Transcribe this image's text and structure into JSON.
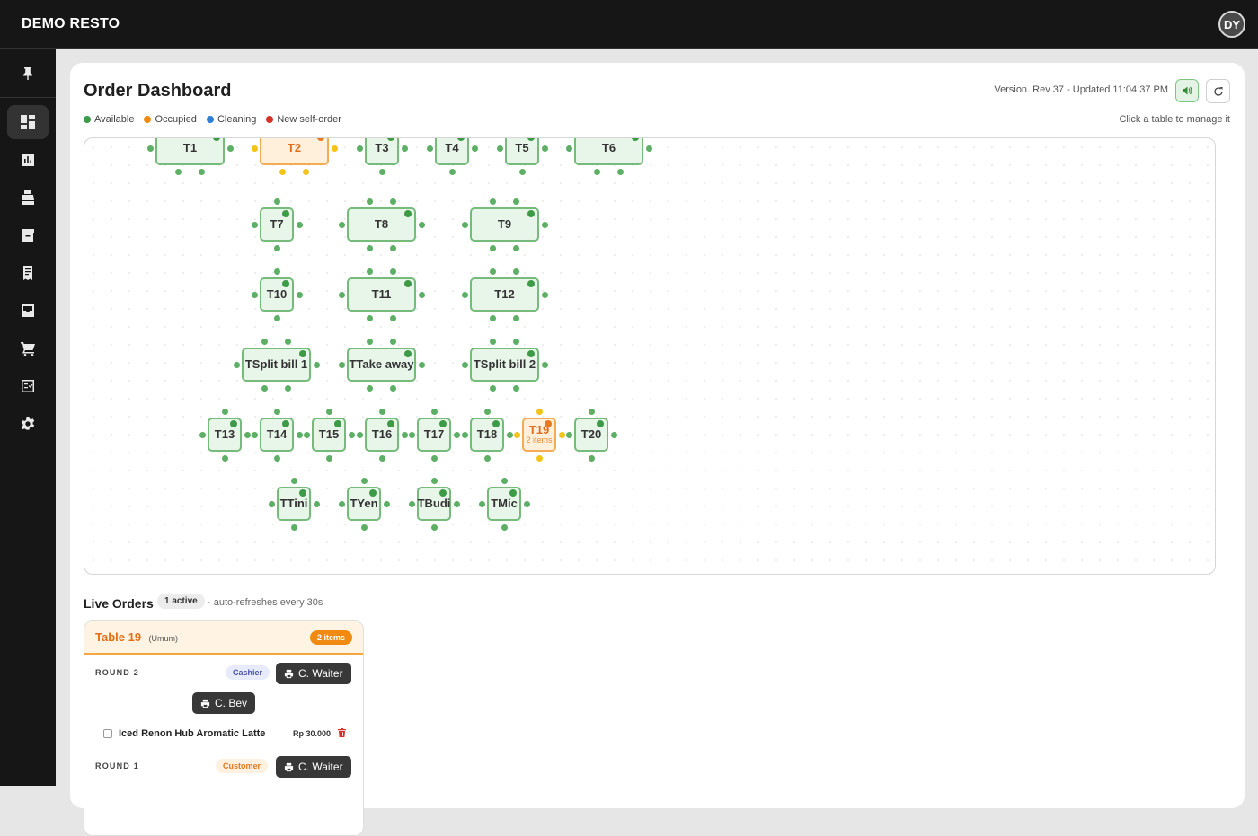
{
  "app": {
    "brand": "DEMO RESTO",
    "user_initials": "DY"
  },
  "sidebar": {
    "items": [
      {
        "icon": "dashboard-icon",
        "active": true
      },
      {
        "icon": "bar-chart-icon"
      },
      {
        "icon": "cash-register-icon"
      },
      {
        "icon": "archive-icon"
      },
      {
        "icon": "receipt-icon"
      },
      {
        "icon": "inbox-icon"
      },
      {
        "icon": "cart-icon"
      },
      {
        "icon": "checklist-icon"
      },
      {
        "icon": "gear-icon"
      }
    ]
  },
  "header": {
    "title": "Order Dashboard",
    "version": "Version. Rev 37 - Updated 11:04:37 PM",
    "hint": "Click a table to manage it"
  },
  "legend": [
    {
      "label": "Available",
      "color": "#3d9a46"
    },
    {
      "label": "Occupied",
      "color": "#f08a12"
    },
    {
      "label": "Cleaning",
      "color": "#2f7fd6"
    },
    {
      "label": "New self-order",
      "color": "#d93025"
    }
  ],
  "tables": [
    {
      "id": "T1",
      "label": "T1",
      "status": "available"
    },
    {
      "id": "T2",
      "label": "T2",
      "status": "occupied"
    },
    {
      "id": "T3",
      "label": "T3",
      "status": "available"
    },
    {
      "id": "T4",
      "label": "T4",
      "status": "available"
    },
    {
      "id": "T5",
      "label": "T5",
      "status": "available"
    },
    {
      "id": "T6",
      "label": "T6",
      "status": "available"
    },
    {
      "id": "T7",
      "label": "T7",
      "status": "available"
    },
    {
      "id": "T8",
      "label": "T8",
      "status": "available"
    },
    {
      "id": "T9",
      "label": "T9",
      "status": "available"
    },
    {
      "id": "T10",
      "label": "T10",
      "status": "available"
    },
    {
      "id": "T11",
      "label": "T11",
      "status": "available"
    },
    {
      "id": "T12",
      "label": "T12",
      "status": "available"
    },
    {
      "id": "TSplit1",
      "label": "TSplit bill 1",
      "status": "available"
    },
    {
      "id": "TTakeaway",
      "label": "TTake away",
      "status": "available"
    },
    {
      "id": "TSplit2",
      "label": "TSplit bill 2",
      "status": "available"
    },
    {
      "id": "T13",
      "label": "T13",
      "status": "available"
    },
    {
      "id": "T14",
      "label": "T14",
      "status": "available"
    },
    {
      "id": "T15",
      "label": "T15",
      "status": "available"
    },
    {
      "id": "T16",
      "label": "T16",
      "status": "available"
    },
    {
      "id": "T17",
      "label": "T17",
      "status": "available"
    },
    {
      "id": "T18",
      "label": "T18",
      "status": "available"
    },
    {
      "id": "T19",
      "label": "T19",
      "status": "occupied",
      "sub": "2 items"
    },
    {
      "id": "T20",
      "label": "T20",
      "status": "available"
    },
    {
      "id": "TTini",
      "label": "TTini",
      "status": "available"
    },
    {
      "id": "TYen",
      "label": "TYen",
      "status": "available"
    },
    {
      "id": "TBudi",
      "label": "TBudi",
      "status": "available"
    },
    {
      "id": "TMic",
      "label": "TMic",
      "status": "available"
    }
  ],
  "live_orders": {
    "title": "Live Orders",
    "active_count": "1 active",
    "note": "· auto-refreshes every 30s",
    "card": {
      "table": "Table 19",
      "type": "(Umum)",
      "items_badge": "2 items",
      "round2": {
        "label": "ROUND 2",
        "source": "Cashier",
        "print_waiter": "C. Waiter",
        "print_bev": "C. Bev",
        "item_name": "Iced Renon Hub Aromatic Latte",
        "item_price": "Rp 30.000"
      },
      "round1": {
        "label": "ROUND 1",
        "source": "Customer",
        "print_waiter": "C. Waiter"
      }
    }
  }
}
